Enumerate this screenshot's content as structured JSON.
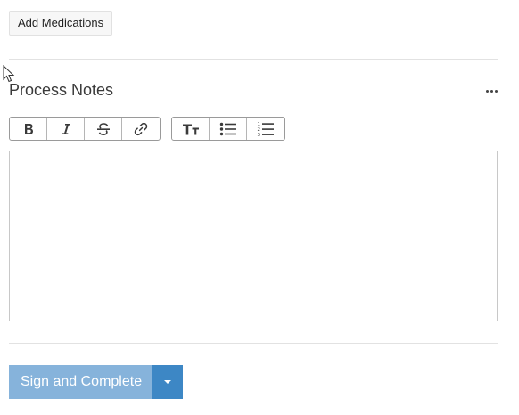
{
  "medications": {
    "add_label": "Add Medications"
  },
  "process_notes": {
    "title": "Process Notes",
    "more_icon": "ellipsis-icon",
    "toolbar": {
      "format_group": [
        {
          "name": "bold",
          "icon": "bold-icon"
        },
        {
          "name": "italic",
          "icon": "italic-icon"
        },
        {
          "name": "strikethrough",
          "icon": "strikethrough-icon"
        },
        {
          "name": "link",
          "icon": "link-icon"
        }
      ],
      "block_group": [
        {
          "name": "heading",
          "icon": "text-size-icon"
        },
        {
          "name": "bulleted-list",
          "icon": "bulleted-list-icon"
        },
        {
          "name": "numbered-list",
          "icon": "numbered-list-icon"
        }
      ]
    },
    "editor_value": ""
  },
  "footer": {
    "sign_label": "Sign and Complete",
    "dropdown_icon": "caret-down-icon"
  },
  "colors": {
    "primary_disabled": "#86b3db",
    "primary": "#3d87c5",
    "divider": "#e2e2e2"
  }
}
